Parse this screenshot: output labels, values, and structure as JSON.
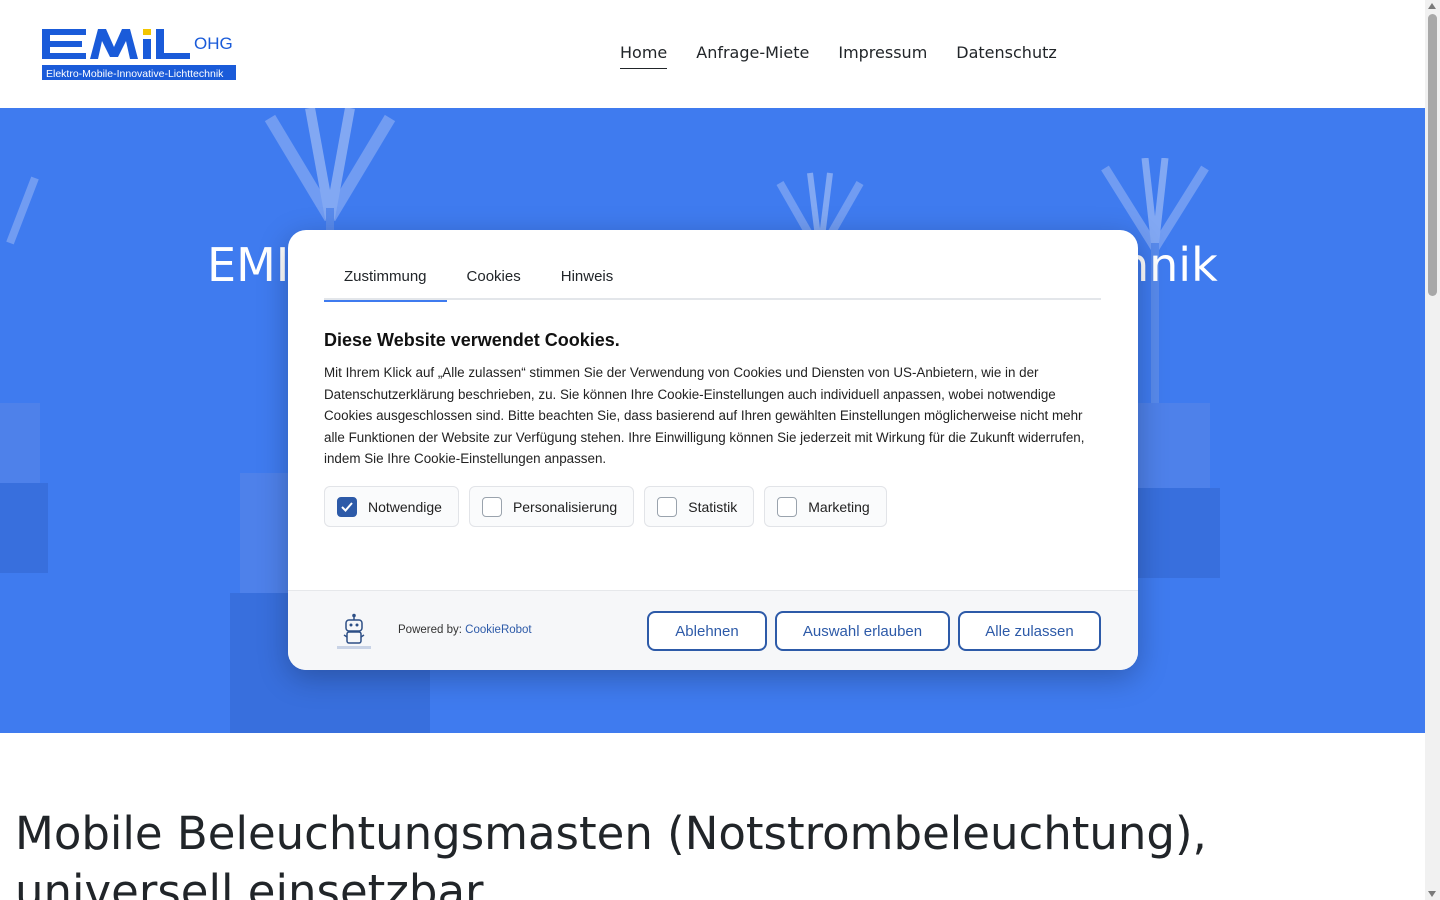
{
  "header": {
    "logo": {
      "main": "EMiL",
      "suffix": "OHG",
      "tagline": "Elektro-Mobile-Innovative-Lichttechnik"
    },
    "nav": [
      "Home",
      "Anfrage-Miete",
      "Impressum",
      "Datenschutz"
    ]
  },
  "hero": {
    "title_left": "EMI",
    "title_right": "nnik"
  },
  "content": {
    "title": "Mobile Beleuchtungsmasten (Notstrombeleuchtung), universell einsetzbar"
  },
  "cookie_dialog": {
    "tabs": [
      "Zustimmung",
      "Cookies",
      "Hinweis"
    ],
    "heading": "Diese Website verwendet Cookies.",
    "text": "Mit Ihrem Klick auf „Alle zulassen“ stimmen Sie der Verwendung von Cookies und Diensten von US-Anbietern, wie in der Datenschutzerklärung beschrieben, zu. Sie können Ihre Cookie-Einstellungen auch individuell anpassen, wobei notwendige Cookies ausgeschlossen sind. Bitte beachten Sie, dass basierend auf Ihren gewählten Einstellungen möglicherweise nicht mehr alle Funktionen der Website zur Verfügung stehen. Ihre Einwilligung können Sie jederzeit mit Wirkung für die Zukunft widerrufen, indem Sie Ihre Cookie-Einstellungen anpassen.",
    "checkboxes": [
      {
        "label": "Notwendige",
        "checked": true
      },
      {
        "label": "Personalisierung",
        "checked": false
      },
      {
        "label": "Statistik",
        "checked": false
      },
      {
        "label": "Marketing",
        "checked": false
      }
    ],
    "powered_by": "Powered by:",
    "powered_link": "CookieRobot",
    "buttons": {
      "reject": "Ablehnen",
      "allow_selection": "Auswahl erlauben",
      "allow_all": "Alle zulassen"
    }
  },
  "colors": {
    "hero": "#3f7bef",
    "accent": "#2d5aa8",
    "logo_blue": "#1a5bd9",
    "logo_yellow": "#f2c500"
  }
}
